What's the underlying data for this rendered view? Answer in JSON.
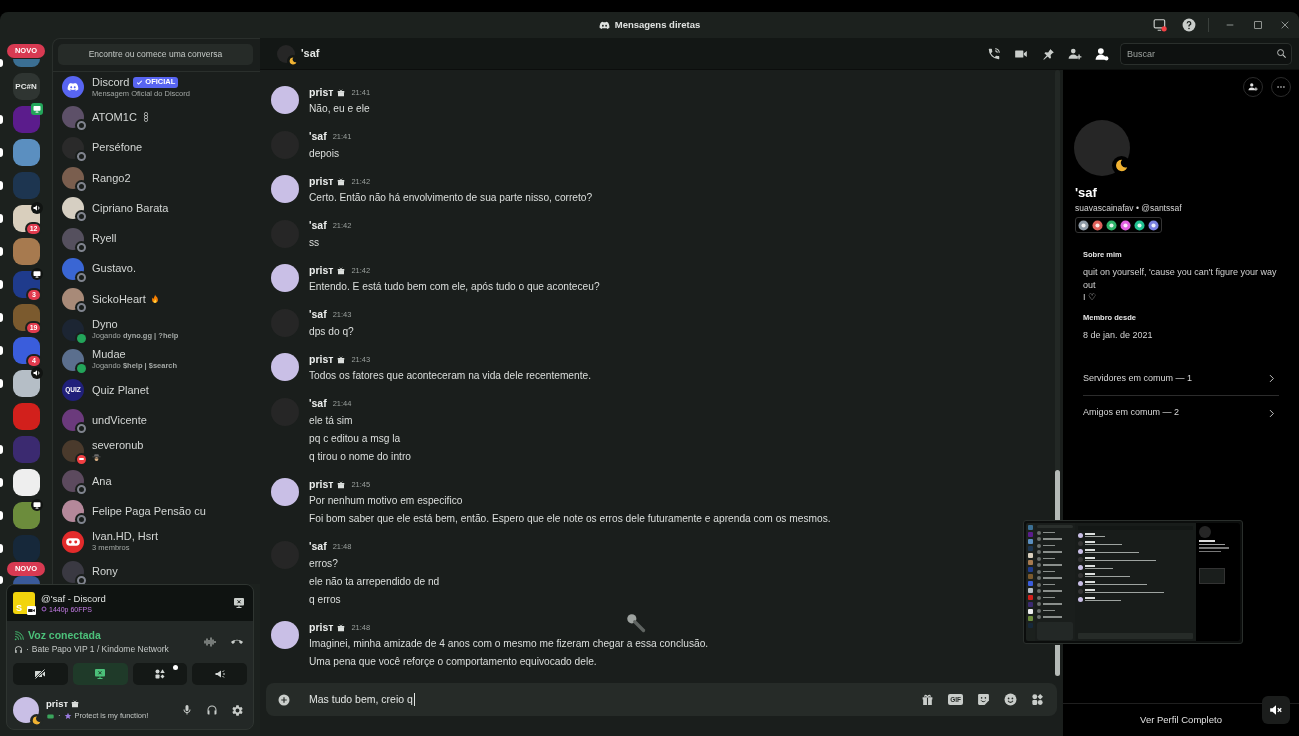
{
  "window": {
    "title": "Mensagens diretas"
  },
  "server_rail": {
    "top_pill": "NOVO",
    "bottom_pill": "NOVO",
    "servers": [
      {
        "kind": "picture",
        "color": "#3b6f93",
        "unread": true
      },
      {
        "kind": "text",
        "label": "PC#N",
        "unread": false
      },
      {
        "kind": "picture",
        "color": "#5b1c8c",
        "unread": true,
        "streaming": true,
        "live": true
      },
      {
        "kind": "picture",
        "color": "#5b8fc0",
        "unread": true
      },
      {
        "kind": "picture",
        "color": "#1d3550",
        "unread": true
      },
      {
        "kind": "picture",
        "color": "#d9cfbd",
        "unread": true,
        "voice_activity": true,
        "badge": "12"
      },
      {
        "kind": "picture",
        "color": "#a77a4f",
        "unread": true
      },
      {
        "kind": "picture",
        "color": "#1f3b8c",
        "unread": true,
        "streaming": true,
        "badge": "3"
      },
      {
        "kind": "picture",
        "color": "#7b5a2e",
        "unread": true,
        "badge": "19"
      },
      {
        "kind": "picture",
        "color": "#3a5ddc",
        "unread": true,
        "badge": "4"
      },
      {
        "kind": "picture",
        "color": "#b5bec6",
        "unread": true,
        "voice_activity": true
      },
      {
        "kind": "picture",
        "color": "#d2201c",
        "unread": false
      },
      {
        "kind": "picture",
        "color": "#3b2a70",
        "unread": true
      },
      {
        "kind": "picture",
        "color": "#eeeeee",
        "unread": true
      },
      {
        "kind": "picture",
        "color": "#6c8c3c",
        "unread": true,
        "streaming": true
      },
      {
        "kind": "picture",
        "color": "#16283a",
        "unread": true
      },
      {
        "kind": "picture",
        "color": "#3a5a9a",
        "unread": true
      }
    ]
  },
  "dm_panel": {
    "search_button": "Encontre ou comece uma conversa",
    "conversations": [
      {
        "kind": "official",
        "name": "Discord",
        "tag": "OFICIAL",
        "subtitle": "Mensagem Oficial do Discord"
      },
      {
        "kind": "user",
        "name": "ATOM1C",
        "status": {
          "kind": "offline",
          "color": "#80848e"
        },
        "color": "#5d5068",
        "name_emoji": {
          "kind": "chain"
        }
      },
      {
        "kind": "user",
        "name": "Perséfone",
        "status": {
          "kind": "offline",
          "color": "#80848e"
        },
        "color": "#2a2a2a"
      },
      {
        "kind": "user",
        "name": "Rango2",
        "status": {
          "kind": "offline",
          "color": "#80848e"
        },
        "color": "#7a5e4e"
      },
      {
        "kind": "user",
        "name": "Cipriano Barata",
        "status": {
          "kind": "offline",
          "color": "#80848e"
        },
        "color": "#d6cfc2"
      },
      {
        "kind": "user",
        "name": "Ryell",
        "status": {
          "kind": "offline",
          "color": "#80848e"
        },
        "color": "#55505e"
      },
      {
        "kind": "user",
        "name": "Gustavo.",
        "status": {
          "kind": "offline",
          "color": "#80848e"
        },
        "color": "#3a66d4"
      },
      {
        "kind": "user",
        "name": "SickoHeart",
        "status": {
          "kind": "offline",
          "color": "#80848e"
        },
        "color": "#a88a78",
        "name_emoji": {
          "kind": "fire"
        }
      },
      {
        "kind": "user",
        "name": "Dyno",
        "status": {
          "kind": "online",
          "color": "#23a55a"
        },
        "color": "#1c2533",
        "subtitle": "Jogando **dyno.gg | ?help**"
      },
      {
        "kind": "user",
        "name": "Mudae",
        "status": {
          "kind": "online",
          "color": "#23a55a"
        },
        "color": "#5b6f8e",
        "subtitle": "Jogando **$help | $search**"
      },
      {
        "kind": "user",
        "name": "Quiz Planet",
        "color": "#20207a",
        "avatar_label": "QUIZ"
      },
      {
        "kind": "user",
        "name": "undVicente",
        "status": {
          "kind": "offline",
          "color": "#80848e"
        },
        "color": "#6b3a7c"
      },
      {
        "kind": "user",
        "name": "severonub",
        "status": {
          "kind": "dnd",
          "color": "#f23f43"
        },
        "color": "#4a3a2c",
        "subtitle_emoji": {
          "kind": "spy"
        }
      },
      {
        "kind": "user",
        "name": "Ana",
        "status": {
          "kind": "offline",
          "color": "#80848e"
        },
        "color": "#5c4a5e"
      },
      {
        "kind": "user",
        "name": "Felipe Paga Pensão cu",
        "status": {
          "kind": "offline",
          "color": "#80848e"
        },
        "color": "#b4889a"
      },
      {
        "kind": "group",
        "name": "Ivan.HD, Hsrt",
        "subtitle": "3 membros"
      },
      {
        "kind": "user",
        "name": "Rony",
        "status": {
          "kind": "offline",
          "color": "#80848e"
        },
        "color": "#3a3942"
      }
    ]
  },
  "call_panel": {
    "stream": {
      "thumb_letter": "S",
      "title": "@'saf - Discord",
      "quality": "1440p 60FPS"
    },
    "voice": {
      "status": "Voz conectada",
      "separator": "·",
      "channel": "Bate Papo VIP 1 / Kindome Network"
    },
    "controls": [
      {
        "kind": "camera",
        "active": false
      },
      {
        "kind": "screen",
        "active": true
      },
      {
        "kind": "activities",
        "active": false,
        "dot": true
      },
      {
        "kind": "soundboard",
        "active": false
      }
    ],
    "user": {
      "name": "prisт",
      "tag_icon": true,
      "status": {
        "kind": "idle",
        "color": "#f0b232"
      },
      "color": "#c9bfe6",
      "separator": "·",
      "status_text": "Protect is my function!"
    }
  },
  "chat_header": {
    "name": "'saf",
    "status": {
      "kind": "idle",
      "color": "#f0b232"
    },
    "color": "#262626",
    "search": {
      "placeholder": "Buscar"
    }
  },
  "messages": [
    {
      "author": "prisт",
      "tag_icon": true,
      "color": "#c9bfe6",
      "time": "21:41",
      "lines": [
        "Não, eu e ele"
      ]
    },
    {
      "author": "'saf",
      "color": "#262626",
      "time": "21:41",
      "lines": [
        "depois"
      ]
    },
    {
      "author": "prisт",
      "tag_icon": true,
      "color": "#c9bfe6",
      "time": "21:42",
      "lines": [
        "Certo. Então não há envolvimento de sua parte nisso, correto?"
      ]
    },
    {
      "author": "'saf",
      "color": "#262626",
      "time": "21:42",
      "lines": [
        "ss"
      ]
    },
    {
      "author": "prisт",
      "tag_icon": true,
      "color": "#c9bfe6",
      "time": "21:42",
      "lines": [
        "Entendo. E está tudo bem com ele, após tudo o que aconteceu?"
      ]
    },
    {
      "author": "'saf",
      "color": "#262626",
      "time": "21:43",
      "lines": [
        "dps do q?"
      ]
    },
    {
      "author": "prisт",
      "tag_icon": true,
      "color": "#c9bfe6",
      "time": "21:43",
      "lines": [
        "Todos os fatores que aconteceram na vida dele recentemente."
      ]
    },
    {
      "author": "'saf",
      "color": "#262626",
      "time": "21:44",
      "lines": [
        "ele tá sim",
        "pq c editou a msg la",
        "q tirou o nome do intro"
      ]
    },
    {
      "author": "prisт",
      "tag_icon": true,
      "color": "#c9bfe6",
      "time": "21:45",
      "lines": [
        "Por nenhum motivo em especifico",
        "Foi bom saber que ele está bem, então. Espero que ele note os erros dele futuramente e aprenda com os mesmos."
      ]
    },
    {
      "author": "'saf",
      "color": "#262626",
      "time": "21:48",
      "lines": [
        "erros?",
        "ele não ta arrependido de nd",
        "q erros"
      ]
    },
    {
      "author": "prisт",
      "tag_icon": true,
      "color": "#c9bfe6",
      "time": "21:48",
      "lines": [
        "Imaginei, minha amizade de 4 anos com o mesmo me fizeram chegar a essa conclusão.",
        "Uma pena que você reforçe o comportamento equivocado dele."
      ]
    }
  ],
  "composer": {
    "value": "Mas tudo bem, creio q",
    "gif_label": "GIF"
  },
  "profile": {
    "display_name": "'saf",
    "status": {
      "kind": "idle",
      "color": "#f0b232"
    },
    "color": "#262626",
    "username_line": "suavascainafav • @santssaf",
    "badges": [
      {
        "color": "#8e9aa6"
      },
      {
        "color": "#e0605a"
      },
      {
        "color": "#2fb36a"
      },
      {
        "color": "#e060e0"
      },
      {
        "color": "#20c090"
      },
      {
        "color": "#7a80e0"
      }
    ],
    "sections": [
      {
        "heading": "Sobre mim",
        "lines": [
          "quit on yourself, 'cause you can't figure your way out",
          "I ♡"
        ]
      },
      {
        "heading": "Membro desde",
        "lines": [
          "8 de jan. de 2021"
        ]
      }
    ],
    "links": [
      "Servidores em comum — 1",
      "Amigos em comum — 2"
    ],
    "footer_button": "Ver Perfil Completo"
  }
}
